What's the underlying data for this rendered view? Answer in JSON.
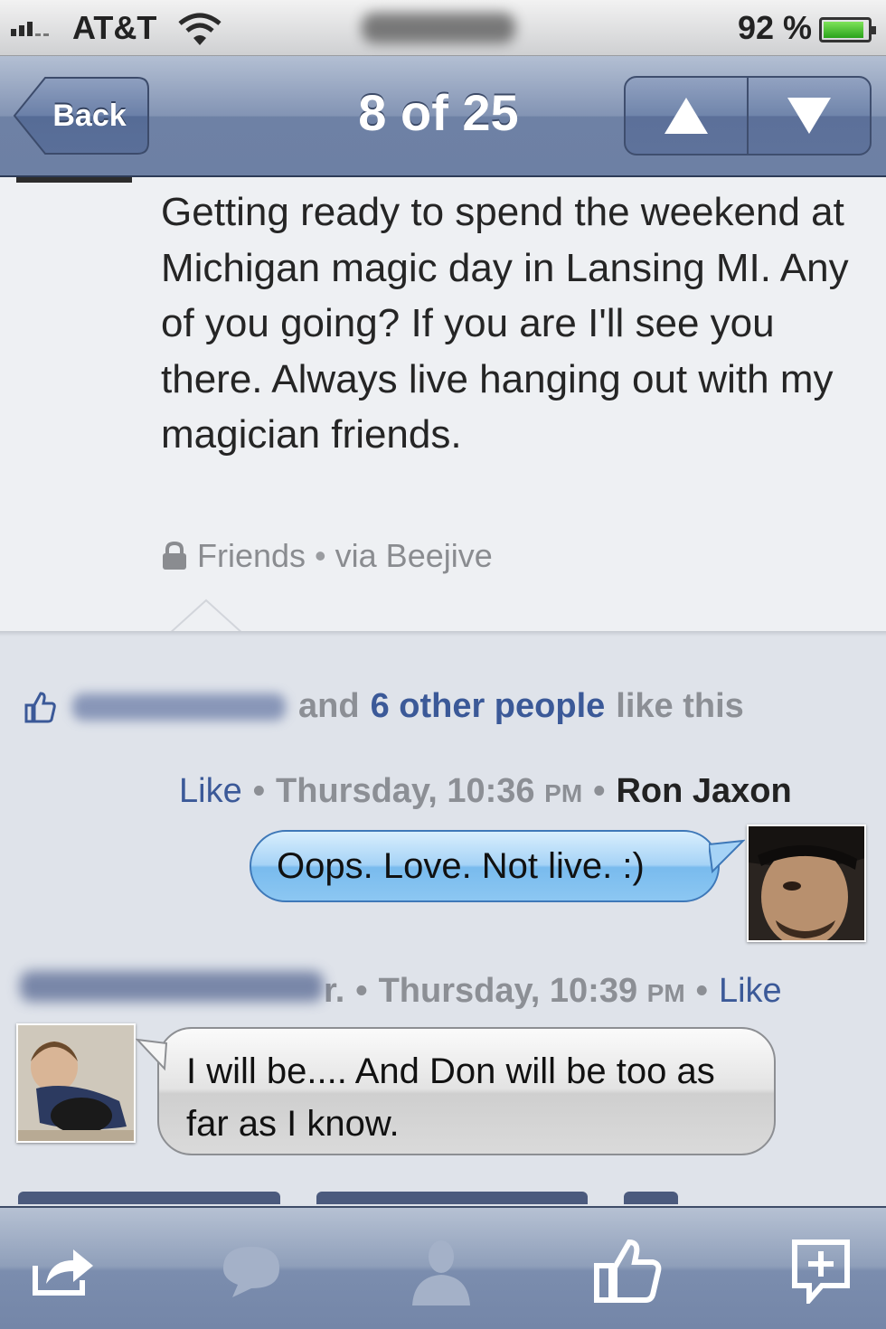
{
  "status_bar": {
    "carrier": "AT&T",
    "battery_percent_label": "92 %",
    "battery_level": 0.92
  },
  "nav": {
    "back_label": "Back",
    "title": "8 of 25",
    "prev_icon": "up-arrow-icon",
    "next_icon": "down-arrow-icon"
  },
  "post": {
    "text": "Getting ready to spend the weekend at Michigan magic day in Lansing MI. Any of you going? If you are I'll see you there. Always live hanging out with my magician friends.",
    "privacy": "Friends",
    "separator": "•",
    "source": "via Beejive"
  },
  "likes": {
    "connector": "and",
    "others_link": "6 other people",
    "suffix": "like this"
  },
  "comments": [
    {
      "like_label": "Like",
      "day": "Thursday,",
      "time": "10:36",
      "ampm": "PM",
      "author": "Ron Jaxon",
      "text": "Oops. Love. Not live. :)"
    },
    {
      "author_suffix": "r.",
      "day": "Thursday,",
      "time": "10:39",
      "ampm": "PM",
      "like_label": "Like",
      "text": "I will be.... And Don will be too as far as I know."
    }
  ],
  "toolbar": {
    "icons": [
      "share-icon",
      "comment-icon",
      "profile-icon",
      "like-icon",
      "add-comment-icon"
    ]
  },
  "colors": {
    "nav_bar": "#7286aa",
    "link_blue": "#3b5998",
    "bubble_blue": "#8cc7f2",
    "background": "#dfe3ea"
  }
}
